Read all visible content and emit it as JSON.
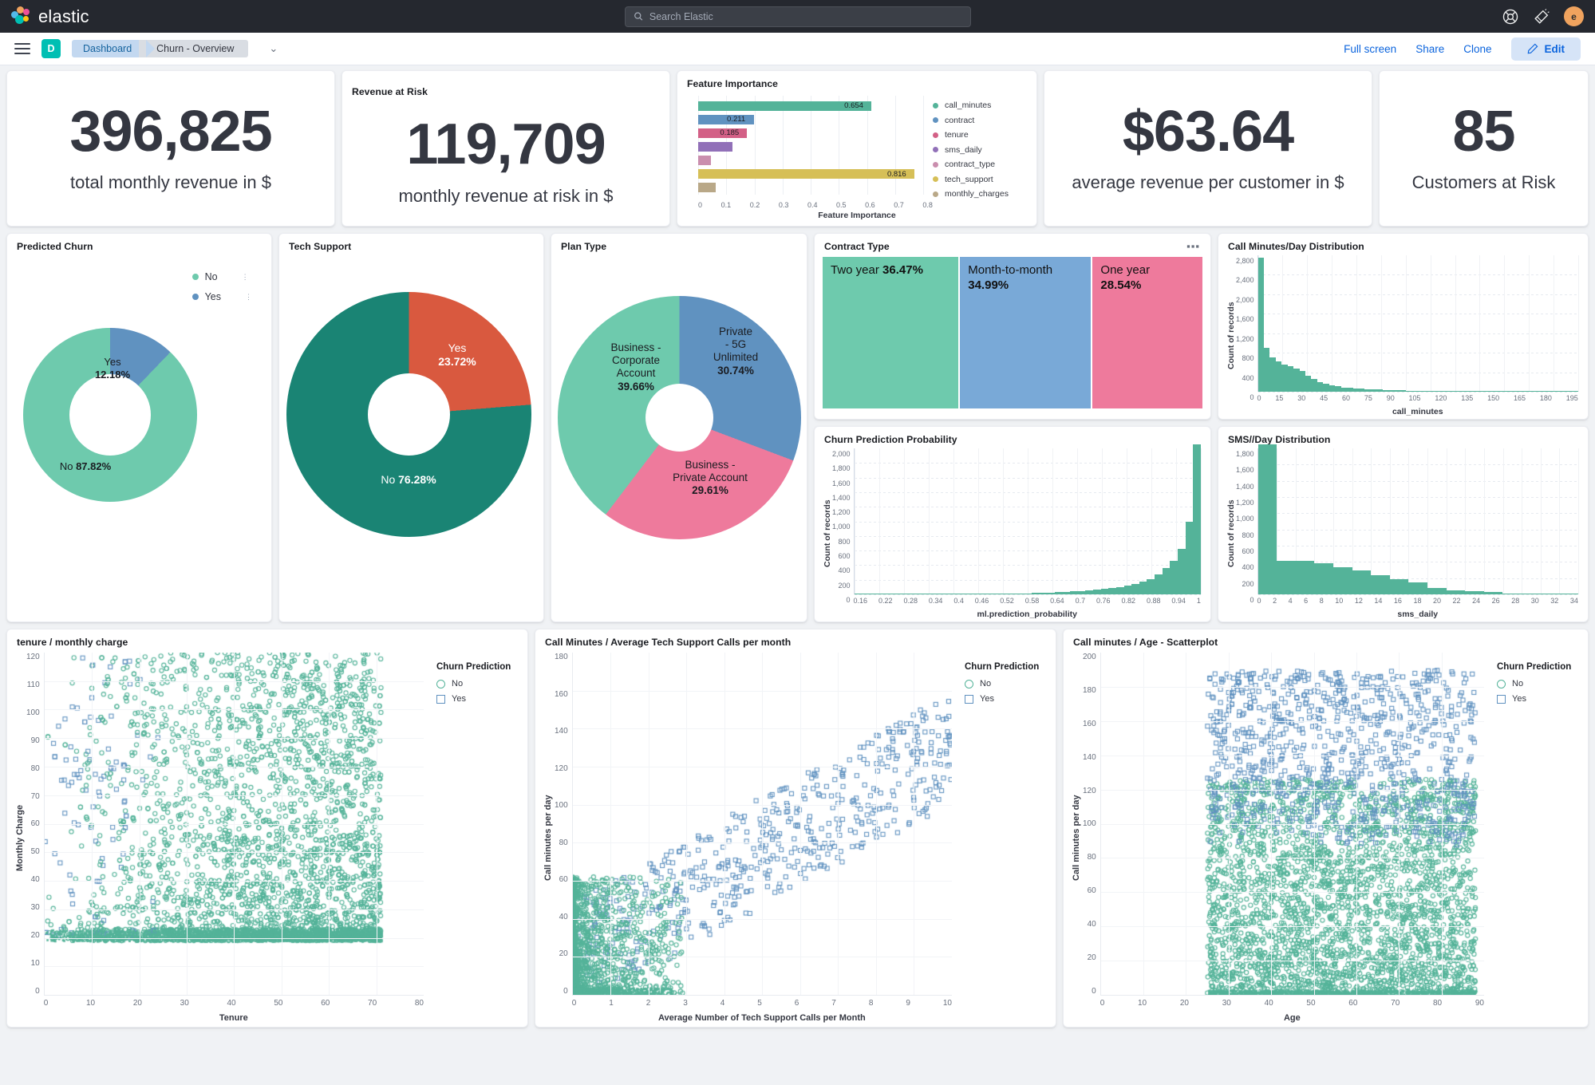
{
  "topnav": {
    "brand": "elastic",
    "search_placeholder": "Search Elastic",
    "search_value": "",
    "icons": [
      "help-icon",
      "announcements-icon"
    ],
    "avatar_initial": "e"
  },
  "breadcrumb": {
    "space_initial": "D",
    "items": [
      "Dashboard",
      "Churn - Overview"
    ],
    "chevron": "⌄",
    "actions": [
      "Full screen",
      "Share",
      "Clone"
    ],
    "edit_label": "Edit"
  },
  "metrics": [
    {
      "title": "",
      "value": "396,825",
      "label": "total monthly revenue in $"
    },
    {
      "title": "Revenue at Risk",
      "value": "119,709",
      "label": "monthly revenue at risk in $"
    },
    {
      "title": "",
      "value": "$63.64",
      "label": "average revenue per customer in $"
    },
    {
      "title": "",
      "value": "85",
      "label": "Customers at Risk"
    }
  ],
  "panels": {
    "feature_importance": "Feature Importance",
    "predicted_churn": "Predicted Churn",
    "tech_support": "Tech Support",
    "plan_type": "Plan Type",
    "contract_type": "Contract Type",
    "call_minutes_dist": "Call Minutes/Day Distribution",
    "churn_probability": "Churn Prediction Probability",
    "sms_dist": "SMS//Day Distribution",
    "tenure_charge": "tenure / monthly charge",
    "call_tech": "Call Minutes / Average Tech Support Calls per month",
    "call_age": "Call minutes / Age - Scatterplot"
  },
  "chart_data": [
    {
      "id": "feature_importance",
      "type": "bar",
      "orientation": "horizontal",
      "title": "Feature Importance",
      "xlabel": "Feature Importance",
      "ylabel": "",
      "xlim": [
        0,
        0.85
      ],
      "xticks": [
        "0",
        "0.1",
        "0.2",
        "0.3",
        "0.4",
        "0.5",
        "0.6",
        "0.7",
        "0.8"
      ],
      "grid": true,
      "legend_position": "right",
      "categories": [
        "call_minutes",
        "contract",
        "tenure",
        "sms_daily",
        "contract_type",
        "tech_support",
        "monthly_charges"
      ],
      "values": [
        0.654,
        0.211,
        0.185,
        0.13,
        0.048,
        0.816,
        0.065
      ],
      "labels": [
        "0.654",
        "0.211",
        "0.185",
        "",
        "",
        "0.816",
        ""
      ],
      "colors": [
        "#54b399",
        "#6092c0",
        "#d36086",
        "#9170b8",
        "#ca8eae",
        "#d6bf57",
        "#b9a888"
      ]
    },
    {
      "id": "predicted_churn",
      "type": "pie",
      "title": "Predicted Churn",
      "donut": true,
      "legend_position": "top-right",
      "categories": [
        "No",
        "Yes"
      ],
      "values": [
        87.82,
        12.18
      ],
      "labels": [
        "No 87.82%",
        "Yes 12.18%"
      ],
      "colors": [
        "#6ecaad",
        "#6092c0"
      ]
    },
    {
      "id": "tech_support",
      "type": "pie",
      "title": "Tech Support",
      "donut": true,
      "categories": [
        "No",
        "Yes"
      ],
      "values": [
        76.28,
        23.72
      ],
      "labels": [
        "No 76.28%",
        "Yes 23.72%"
      ],
      "colors": [
        "#1a8474",
        "#d9593f"
      ]
    },
    {
      "id": "plan_type",
      "type": "pie",
      "title": "Plan Type",
      "donut": true,
      "categories": [
        "Business - Corporate Account",
        "Private - 5G Unlimited",
        "Business - Private Account"
      ],
      "values": [
        39.66,
        30.74,
        29.61
      ],
      "labels": [
        "Business - Corporate Account 39.66%",
        "Private - 5G Unlimited 30.74%",
        "Business - Private Account 29.61%"
      ],
      "colors": [
        "#6ecaad",
        "#6092c0",
        "#ee7a9c"
      ]
    },
    {
      "id": "contract_type",
      "type": "treemap",
      "title": "Contract Type",
      "categories": [
        "Two year",
        "Month-to-month",
        "One year"
      ],
      "values": [
        36.47,
        34.99,
        28.54
      ],
      "labels": [
        "Two year 36.47%",
        "Month-to-month 34.99%",
        "One year 28.54%"
      ],
      "colors": [
        "#6ecaad",
        "#79a9d7",
        "#ee7a9c"
      ]
    },
    {
      "id": "call_minutes_dist",
      "type": "bar",
      "title": "Call Minutes/Day Distribution",
      "xlabel": "call_minutes",
      "ylabel": "Count of records",
      "ylim": [
        0,
        2800
      ],
      "yticks": [
        "2,800",
        "2,400",
        "2,000",
        "1,600",
        "1,200",
        "800",
        "400",
        "0"
      ],
      "xticks": [
        "0",
        "15",
        "30",
        "45",
        "60",
        "75",
        "90",
        "105",
        "120",
        "135",
        "150",
        "165",
        "180",
        "195"
      ],
      "values": [
        2750,
        900,
        700,
        620,
        560,
        520,
        470,
        420,
        330,
        260,
        200,
        160,
        130,
        110,
        90,
        80,
        70,
        60,
        55,
        50,
        45,
        40,
        35,
        30,
        28,
        24,
        22,
        20,
        18,
        16,
        14,
        12,
        11,
        10,
        9,
        8,
        7,
        6,
        5,
        5,
        4,
        4,
        3,
        3,
        2,
        2,
        2,
        1,
        1,
        1,
        1,
        1,
        1,
        1
      ]
    },
    {
      "id": "churn_probability",
      "type": "bar",
      "title": "Churn Prediction Probability",
      "xlabel": "ml.prediction_probability",
      "ylabel": "Count of records",
      "ylim": [
        0,
        2000
      ],
      "yticks": [
        "2,000",
        "1,800",
        "1,600",
        "1,400",
        "1,200",
        "1,000",
        "800",
        "600",
        "400",
        "200",
        "0"
      ],
      "xticks": [
        "0.16",
        "0.22",
        "0.28",
        "0.34",
        "0.4",
        "0.46",
        "0.52",
        "0.58",
        "0.64",
        "0.7",
        "0.76",
        "0.82",
        "0.88",
        "0.94",
        "1"
      ],
      "values": [
        2,
        2,
        2,
        2,
        3,
        3,
        3,
        3,
        4,
        4,
        4,
        5,
        5,
        5,
        6,
        6,
        7,
        7,
        8,
        9,
        10,
        12,
        14,
        18,
        22,
        26,
        30,
        36,
        42,
        48,
        56,
        64,
        74,
        86,
        100,
        118,
        140,
        170,
        210,
        270,
        360,
        460,
        620,
        1000,
        2060
      ]
    },
    {
      "id": "sms_dist",
      "type": "bar",
      "title": "SMS//Day Distribution",
      "xlabel": "sms_daily",
      "ylabel": "Count of records",
      "ylim": [
        0,
        1800
      ],
      "yticks": [
        "1,800",
        "1,600",
        "1,400",
        "1,200",
        "1,000",
        "800",
        "600",
        "400",
        "200",
        "0"
      ],
      "xticks": [
        "0",
        "2",
        "4",
        "6",
        "8",
        "10",
        "12",
        "14",
        "16",
        "18",
        "20",
        "22",
        "24",
        "26",
        "28",
        "30",
        "32",
        "34"
      ],
      "values": [
        1850,
        415,
        410,
        385,
        335,
        300,
        240,
        185,
        150,
        75,
        50,
        38,
        28,
        12,
        3,
        1,
        0
      ]
    },
    {
      "id": "tenure_charge",
      "type": "scatter",
      "title": "tenure / monthly charge",
      "xlabel": "Tenure",
      "ylabel": "Monthly Charge",
      "xlim": [
        0,
        80
      ],
      "ylim": [
        0,
        120
      ],
      "xticks": [
        "0",
        "10",
        "20",
        "30",
        "40",
        "50",
        "60",
        "70",
        "80"
      ],
      "yticks": [
        "120",
        "110",
        "100",
        "90",
        "80",
        "70",
        "60",
        "50",
        "40",
        "30",
        "20",
        "10",
        "0"
      ],
      "legend_title": "Churn Prediction",
      "series": [
        {
          "name": "No",
          "marker": "circle",
          "color": "#54b399"
        },
        {
          "name": "Yes",
          "marker": "square",
          "color": "#6092c0"
        }
      ]
    },
    {
      "id": "call_tech",
      "type": "scatter",
      "title": "Call Minutes / Average Tech Support Calls per month",
      "xlabel": "Average Number of Tech Support Calls per Month",
      "ylabel": "Call minutes per day",
      "xlim": [
        0,
        10
      ],
      "ylim": [
        0,
        180
      ],
      "xticks": [
        "0",
        "1",
        "2",
        "3",
        "4",
        "5",
        "6",
        "7",
        "8",
        "9",
        "10"
      ],
      "yticks": [
        "180",
        "160",
        "140",
        "120",
        "100",
        "80",
        "60",
        "40",
        "20",
        "0"
      ],
      "legend_title": "Churn Prediction",
      "series": [
        {
          "name": "No",
          "marker": "circle",
          "color": "#54b399"
        },
        {
          "name": "Yes",
          "marker": "square",
          "color": "#6092c0"
        }
      ]
    },
    {
      "id": "call_age",
      "type": "scatter",
      "title": "Call minutes / Age - Scatterplot",
      "xlabel": "Age",
      "ylabel": "Call minutes per day",
      "xlim": [
        0,
        90
      ],
      "ylim": [
        0,
        200
      ],
      "xticks": [
        "0",
        "10",
        "20",
        "30",
        "40",
        "50",
        "60",
        "70",
        "80",
        "90"
      ],
      "yticks": [
        "200",
        "180",
        "160",
        "140",
        "120",
        "100",
        "80",
        "60",
        "40",
        "20",
        "0"
      ],
      "legend_title": "Churn Prediction",
      "series": [
        {
          "name": "No",
          "marker": "circle",
          "color": "#54b399"
        },
        {
          "name": "Yes",
          "marker": "square",
          "color": "#6092c0"
        }
      ]
    }
  ]
}
